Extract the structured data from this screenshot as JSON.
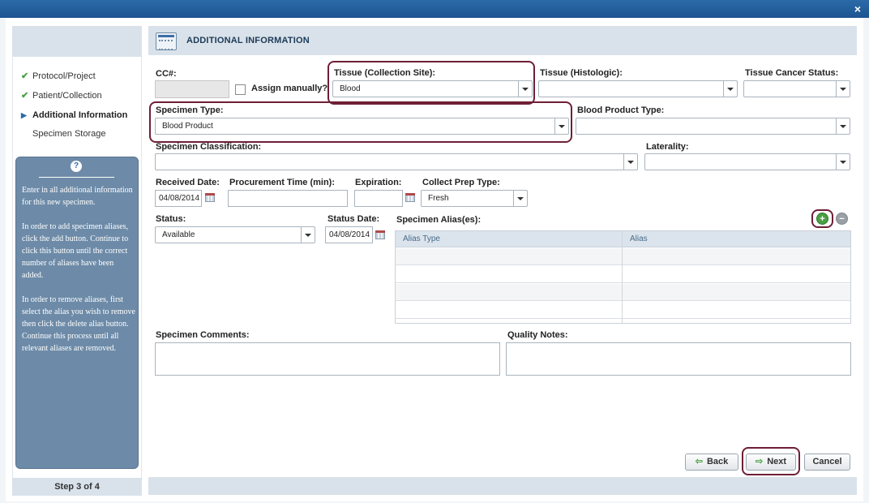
{
  "window": {
    "close_icon": "close-x-icon",
    "close_glyph": "×"
  },
  "sidebar": {
    "steps": [
      {
        "label": "Protocol/Project",
        "state": "done",
        "icon": "checkmark-icon",
        "glyph": "✔"
      },
      {
        "label": "Patient/Collection",
        "state": "done",
        "icon": "checkmark-icon",
        "glyph": "✔"
      },
      {
        "label": "Additional Information",
        "state": "current",
        "icon": "triangle-right-icon",
        "glyph": "▶"
      },
      {
        "label": "Specimen Storage",
        "state": "pending",
        "icon": "",
        "glyph": ""
      }
    ],
    "help_icon": "?",
    "help_text": "Enter in all additional information for this new specimen.\n\nIn order to add specimen aliases, click the add button. Continue to click this button until the correct number of aliases have been added.\n\nIn order to remove aliases, first select the alias you wish to remove then click the delete alias button.  Continue this process until all relevant aliases are removed.",
    "step_indicator": "Step 3 of 4"
  },
  "header": {
    "title": "ADDITIONAL INFORMATION"
  },
  "form": {
    "cc_label": "CC#:",
    "cc_value": "",
    "assign_manually_label": "Assign manually?",
    "assign_manually_checked": false,
    "tissue_collection_label": "Tissue (Collection Site):",
    "tissue_collection_value": "Blood",
    "tissue_histologic_label": "Tissue (Histologic):",
    "tissue_histologic_value": "",
    "tissue_cancer_status_label": "Tissue Cancer Status:",
    "tissue_cancer_status_value": "",
    "specimen_type_label": "Specimen Type:",
    "specimen_type_value": "Blood Product",
    "blood_product_type_label": "Blood Product Type:",
    "blood_product_type_value": "",
    "specimen_classification_label": "Specimen Classification:",
    "specimen_classification_value": "",
    "laterality_label": "Laterality:",
    "laterality_value": "",
    "received_date_label": "Received Date:",
    "received_date_value": "04/08/2014",
    "procurement_time_label": "Procurement Time (min):",
    "procurement_time_value": "",
    "expiration_label": "Expiration:",
    "expiration_value": "",
    "collect_prep_type_label": "Collect Prep Type:",
    "collect_prep_type_value": "Fresh",
    "status_label": "Status:",
    "status_value": "Available",
    "status_date_label": "Status Date:",
    "status_date_value": "04/08/2014",
    "specimen_alias_label": "Specimen Alias(es):",
    "specimen_comments_label": "Specimen Comments:",
    "specimen_comments_value": "",
    "quality_notes_label": "Quality Notes:",
    "quality_notes_value": ""
  },
  "alias_table": {
    "columns": [
      "Alias Type",
      "Alias"
    ],
    "rows": [
      [
        "",
        ""
      ],
      [
        "",
        ""
      ],
      [
        "",
        ""
      ],
      [
        "",
        ""
      ]
    ],
    "add_button": "+",
    "remove_button": "−"
  },
  "buttons": {
    "back_label": "Back",
    "back_arrow": "⇦",
    "next_label": "Next",
    "next_arrow": "⇨",
    "cancel_label": "Cancel"
  },
  "colors": {
    "highlight_outline": "#6e1f36",
    "header_bg": "#d9e2ea",
    "help_panel_bg": "#6d8ba8",
    "titlebar": "#1d5590",
    "add_green": "#49a043"
  }
}
